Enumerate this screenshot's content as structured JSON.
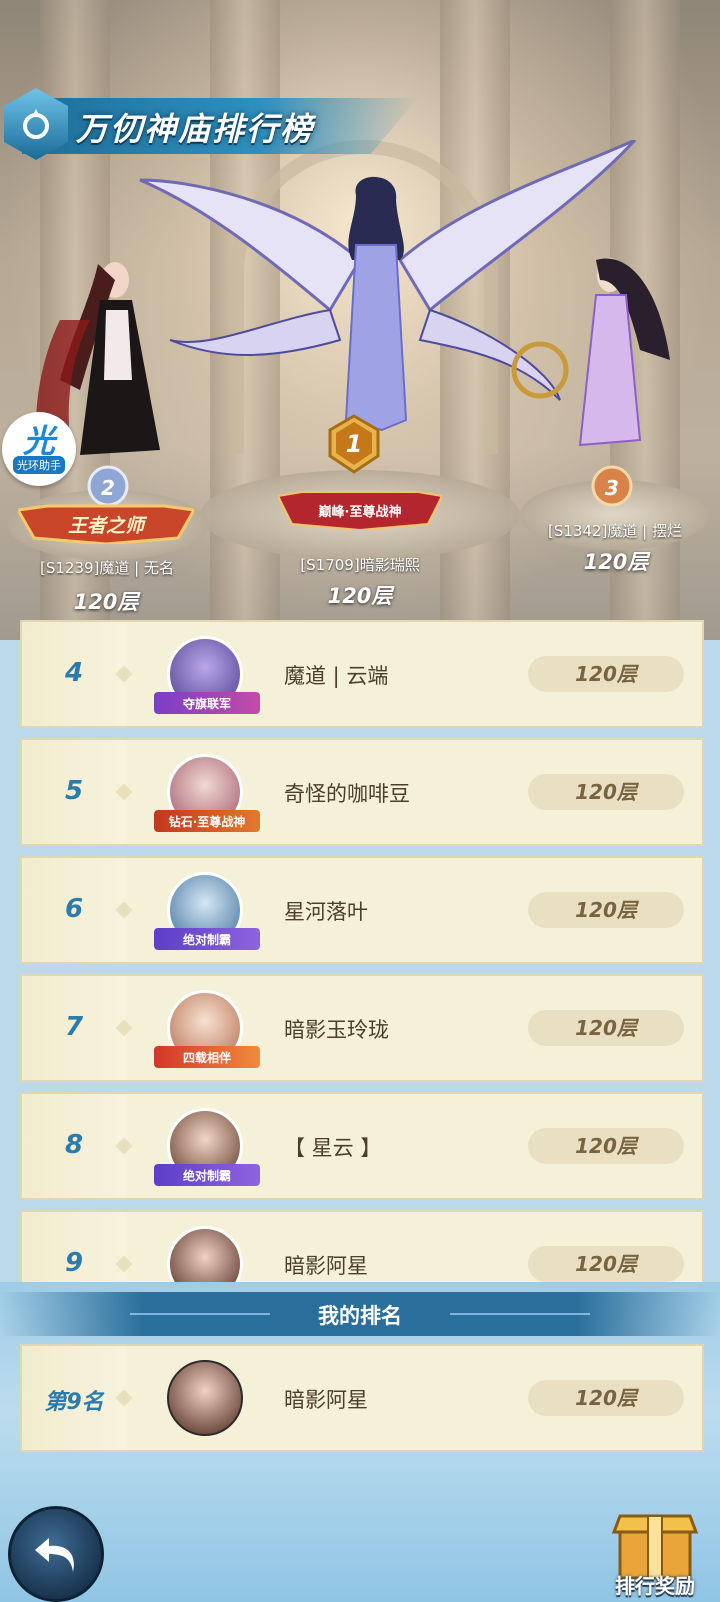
{
  "header": {
    "title": "万仞神庙排行榜"
  },
  "helper": {
    "glyph": "光",
    "label": "光环助手"
  },
  "podium": [
    {
      "rank": "1",
      "banner": "巅峰·至尊战神",
      "name": "[S1709]暗影瑞熙",
      "floor": "120层"
    },
    {
      "rank": "2",
      "banner": "王者之师",
      "name": "[S1239]魔道 | 无名",
      "floor": "120层"
    },
    {
      "rank": "3",
      "banner": "",
      "name": "[S1342]魔道 | 摆烂",
      "floor": "120层"
    }
  ],
  "list": [
    {
      "rank": "4",
      "name": "魔道 | 云端",
      "floor": "120层",
      "badge": "夺旗联军"
    },
    {
      "rank": "5",
      "name": "奇怪的咖啡豆",
      "floor": "120层",
      "badge": "钻石·至尊战神"
    },
    {
      "rank": "6",
      "name": "星河落叶",
      "floor": "120层",
      "badge": "绝对制霸"
    },
    {
      "rank": "7",
      "name": "暗影玉玲珑",
      "floor": "120层",
      "badge": "四载相伴"
    },
    {
      "rank": "8",
      "name": "【 星云 】",
      "floor": "120层",
      "badge": "绝对制霸"
    },
    {
      "rank": "9",
      "name": "暗影阿星",
      "floor": "120层",
      "badge": ""
    }
  ],
  "my_rank": {
    "section_title": "我的排名",
    "rank_label": "第9名",
    "name": "暗影阿星",
    "floor": "120层"
  },
  "footer": {
    "reward_label": "排行奖励"
  },
  "colors": {
    "accent": "#2a7cae",
    "row_bg": "#f4f1d8",
    "header_blue": "#2a6f9b"
  }
}
